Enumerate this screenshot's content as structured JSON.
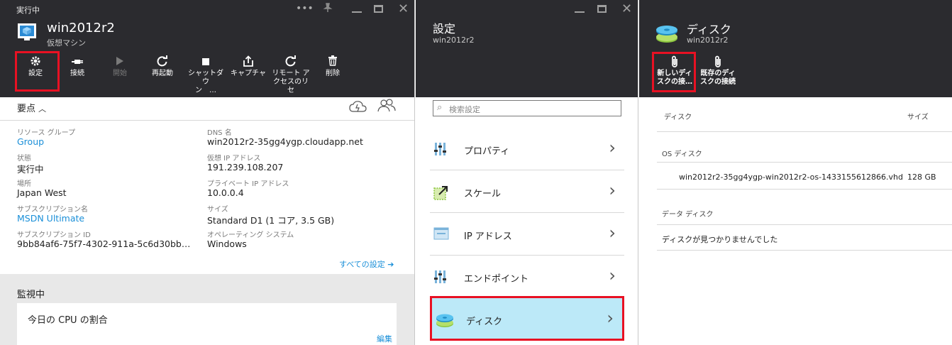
{
  "vm_blade": {
    "status": "実行中",
    "title": "win2012r2",
    "subtitle": "仮想マシン",
    "toolbar": [
      {
        "label": "設定",
        "icon": "gear-icon"
      },
      {
        "label": "接続",
        "icon": "plug-icon"
      },
      {
        "label": "開始",
        "icon": "play-icon"
      },
      {
        "label": "再起動",
        "icon": "restart-icon"
      },
      {
        "label": "シャットダウ\nン　…",
        "icon": "stop-icon"
      },
      {
        "label": "キャプチャ",
        "icon": "capture-icon"
      },
      {
        "label": "リモート ア\nクセスのリセ",
        "icon": "reset-icon"
      },
      {
        "label": "削除",
        "icon": "trash-icon"
      }
    ],
    "essentials_label": "要点",
    "fields_left": [
      {
        "label": "リソース グループ",
        "value": "Group",
        "link": true
      },
      {
        "label": "状態",
        "value": "実行中",
        "link": false
      },
      {
        "label": "場所",
        "value": "Japan West",
        "link": false
      },
      {
        "label": "サブスクリプション名",
        "value": "MSDN Ultimate",
        "link": true
      },
      {
        "label": "サブスクリプション ID",
        "value": "9bb84af6-75f7-4302-911a-5c6d30bb…",
        "link": false
      }
    ],
    "fields_right": [
      {
        "label": "DNS 名",
        "value": "win2012r2-35gg4ygp.cloudapp.net"
      },
      {
        "label": "仮想 IP アドレス",
        "value": "191.239.108.207"
      },
      {
        "label": "プライベート IP アドレス",
        "value": "10.0.0.4"
      },
      {
        "label": "サイズ",
        "value": "Standard D1 (1 コア, 3.5 GB)"
      },
      {
        "label": "オペレーティング システム",
        "value": "Windows"
      }
    ],
    "all_settings": "すべての設定 ➔",
    "monitoring_title": "監視中",
    "cpu_card_title": "今日の CPU の割合",
    "edit_label": "編集"
  },
  "settings_blade": {
    "title": "設定",
    "subtitle": "win2012r2",
    "search_placeholder": "検索設定",
    "items": [
      {
        "label": "プロパティ",
        "icon": "properties-icon"
      },
      {
        "label": "スケール",
        "icon": "scale-icon"
      },
      {
        "label": "IP アドレス",
        "icon": "ip-address-icon"
      },
      {
        "label": "エンドポイント",
        "icon": "endpoint-icon"
      },
      {
        "label": "ディスク",
        "icon": "disk-icon"
      }
    ]
  },
  "disk_blade": {
    "title": "ディスク",
    "subtitle": "win2012r2",
    "toolbar": [
      {
        "label": "新しいディ\nスクの接…",
        "icon": "paperclip-icon"
      },
      {
        "label": "既存のディ\nスクの接続",
        "icon": "paperclip-icon"
      }
    ],
    "col_disk": "ディスク",
    "col_size": "サイズ",
    "os_disk_label": "OS ディスク",
    "os_disk_name": "win2012r2-35gg4ygp-win2012r2-os-1433155612866.vhd",
    "os_disk_size": "128 GB",
    "data_disk_label": "データ ディスク",
    "no_disk_text": "ディスクが見つかりませんでした"
  },
  "colors": {
    "header_bg": "#2b2b2f",
    "accent": "#1a8fd8",
    "highlight": "#e81123",
    "selected_bg": "#bce9f8"
  }
}
